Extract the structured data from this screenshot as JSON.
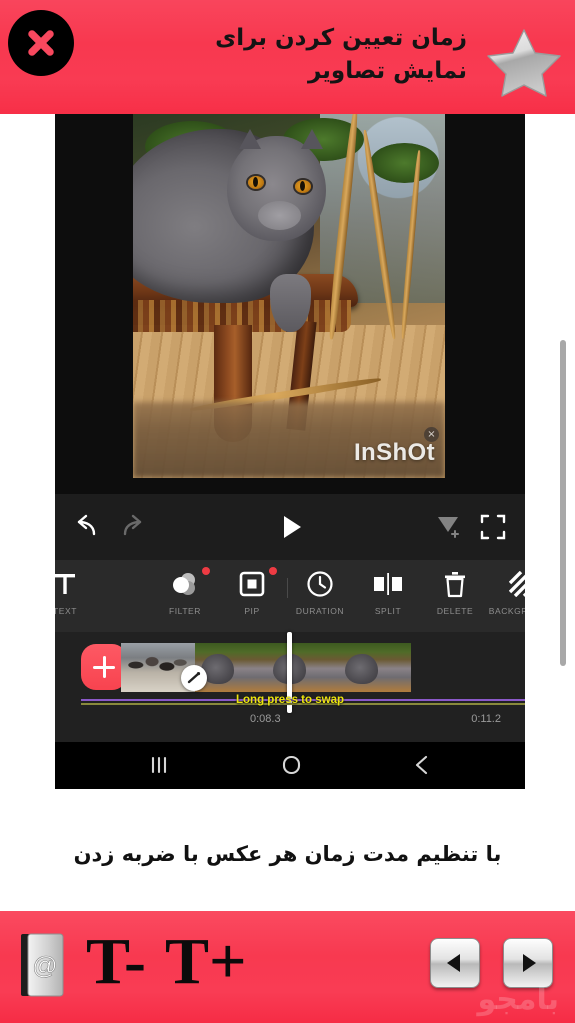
{
  "header": {
    "title": "زمان تعیین کردن برای نمایش تصاویر",
    "close_icon": "close-x-icon",
    "favorite_icon": "star-icon",
    "background_color": "#f8384f"
  },
  "phone": {
    "preview": {
      "watermark": "InShOt",
      "watermark_close": "×",
      "photo_alt": "gray-cat-on-wooden-chair"
    },
    "player_controls": [
      {
        "name": "undo",
        "icon": "undo-arrow-icon",
        "enabled": true
      },
      {
        "name": "redo",
        "icon": "redo-arrow-icon",
        "enabled": false
      },
      {
        "name": "play",
        "icon": "play-triangle-icon",
        "enabled": true
      },
      {
        "name": "marker",
        "icon": "marker-add-icon",
        "enabled": false
      },
      {
        "name": "fullscreen",
        "icon": "fullscreen-icon",
        "enabled": true
      }
    ],
    "tools": [
      {
        "label": "TEXT",
        "icon": "text-t-icon",
        "badge": false
      },
      {
        "label": "FILTER",
        "icon": "filter-circles-icon",
        "badge": true
      },
      {
        "label": "PIP",
        "icon": "pip-square-icon",
        "badge": true
      },
      {
        "label": "DURATION",
        "icon": "clock-icon",
        "badge": false
      },
      {
        "label": "SPLIT",
        "icon": "split-icon",
        "badge": false
      },
      {
        "label": "DELETE",
        "icon": "trash-icon",
        "badge": false
      },
      {
        "label": "BACKGROUND",
        "icon": "diagonal-stripes-icon",
        "badge": true
      }
    ],
    "timeline": {
      "add_button_icon": "plus-icon",
      "swap_hint": "Long press to swap",
      "transition_icon": "transition-badge-icon",
      "time_current": "0:08.3",
      "time_total": "0:11.2",
      "playhead": "playhead-handle",
      "track_colors": {
        "olive": "#8a8a3c",
        "purple": "#8b59c9"
      },
      "accent_color": "#f8434f",
      "hint_color": "#ece50f"
    },
    "navbar": [
      {
        "name": "recents",
        "icon": "recents-bars-icon",
        "glyph": "|||"
      },
      {
        "name": "home",
        "icon": "home-circle-icon",
        "glyph": "O"
      },
      {
        "name": "back",
        "icon": "back-chevron-icon",
        "glyph": "<"
      }
    ]
  },
  "caption": {
    "text": "با تنظیم مدت زمان هر عکس با ضربه زدن"
  },
  "footer": {
    "bookmark_icon": "address-book-at-icon",
    "text_decrease": "T-",
    "text_increase": "T+",
    "prev_icon": "prev-triangle-icon",
    "next_icon": "next-triangle-icon",
    "watermark": "بامجو",
    "background_color": "#f8394f"
  },
  "scrollbar": {
    "name": "page-scrollbar"
  }
}
